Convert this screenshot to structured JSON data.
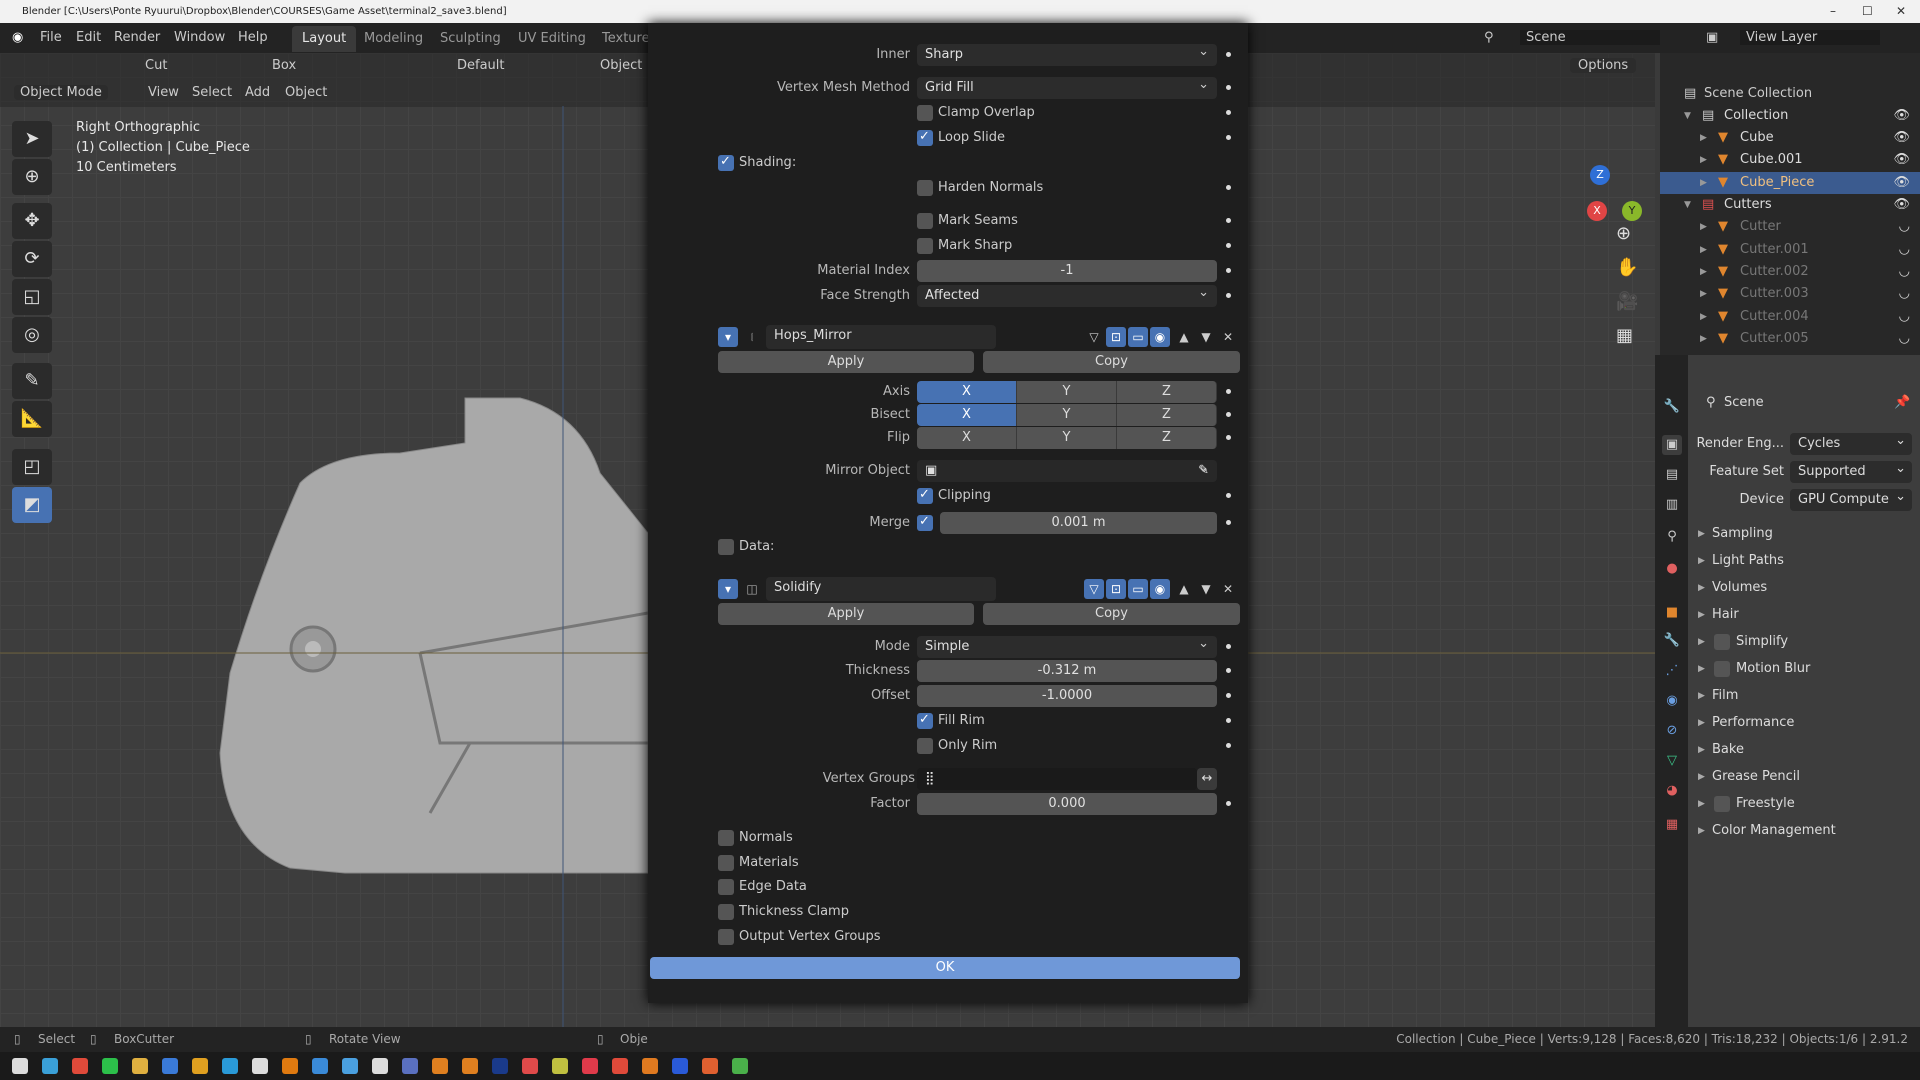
{
  "window": {
    "title": "Blender [C:\\Users\\Ponte Ryuurui\\Dropbox\\Blender\\COURSES\\Game Asset\\terminal2_save3.blend]",
    "min": "–",
    "max": "☐",
    "close": "✕"
  },
  "menu": {
    "items": [
      "File",
      "Edit",
      "Render",
      "Window",
      "Help"
    ],
    "workspaces": [
      "Layout",
      "Modeling",
      "Sculpting",
      "UV Editing",
      "Texture"
    ],
    "active_workspace": "Layout",
    "scene": "Scene",
    "view_layer": "View Layer"
  },
  "tool_header": {
    "operation": "Cut",
    "shape": "Box",
    "orientation": "Default",
    "target": "Object",
    "options": "Options"
  },
  "view_header": {
    "mode": "Object Mode",
    "items": [
      "View",
      "Select",
      "Add",
      "Object"
    ]
  },
  "viewport": {
    "view_name": "Right Orthographic",
    "context": "(1) Collection | Cube_Piece",
    "scale": "10 Centimeters",
    "gizmo": {
      "x": "X",
      "y": "Y",
      "z": "Z"
    }
  },
  "dialog": {
    "inner_label": "Inner",
    "inner_value": "Sharp",
    "vmm_label": "Vertex Mesh Method",
    "vmm_value": "Grid Fill",
    "clamp_overlap": {
      "label": "Clamp Overlap",
      "checked": false
    },
    "loop_slide": {
      "label": "Loop Slide",
      "checked": true
    },
    "shading": {
      "label": "Shading:",
      "checked": true
    },
    "harden_normals": {
      "label": "Harden Normals",
      "checked": false
    },
    "mark_seams": {
      "label": "Mark Seams",
      "checked": false
    },
    "mark_sharp": {
      "label": "Mark Sharp",
      "checked": false
    },
    "material_index_label": "Material Index",
    "material_index_value": "-1",
    "face_strength_label": "Face Strength",
    "face_strength_value": "Affected",
    "mirror": {
      "name": "Hops_Mirror",
      "apply": "Apply",
      "copy": "Copy",
      "axis_label": "Axis",
      "bisect_label": "Bisect",
      "flip_label": "Flip",
      "axes": [
        "X",
        "Y",
        "Z"
      ],
      "axis_on": [
        true,
        false,
        false
      ],
      "bisect_on": [
        true,
        false,
        false
      ],
      "flip_on": [
        false,
        false,
        false
      ],
      "mirror_object_label": "Mirror Object",
      "clipping": {
        "label": "Clipping",
        "checked": true
      },
      "merge_label": "Merge",
      "merge_checked": true,
      "merge_value": "0.001 m",
      "data": {
        "label": "Data:",
        "checked": false
      }
    },
    "solidify": {
      "name": "Solidify",
      "apply": "Apply",
      "copy": "Copy",
      "mode_label": "Mode",
      "mode_value": "Simple",
      "thickness_label": "Thickness",
      "thickness_value": "-0.312 m",
      "offset_label": "Offset",
      "offset_value": "-1.0000",
      "fill_rim": {
        "label": "Fill Rim",
        "checked": true
      },
      "only_rim": {
        "label": "Only Rim",
        "checked": false
      },
      "vertex_groups_label": "Vertex Groups",
      "factor_label": "Factor",
      "factor_value": "0.000",
      "normals": {
        "label": "Normals",
        "checked": false
      },
      "materials": {
        "label": "Materials",
        "checked": false
      },
      "edge_data": {
        "label": "Edge Data",
        "checked": false
      },
      "thickness_clamp": {
        "label": "Thickness Clamp",
        "checked": false
      },
      "output_vertex_groups": {
        "label": "Output Vertex Groups",
        "checked": false
      }
    },
    "ok": "OK"
  },
  "outliner": {
    "root": "Scene Collection",
    "items": [
      {
        "name": "Collection",
        "type": "collection",
        "level": 1
      },
      {
        "name": "Cube",
        "type": "mesh",
        "level": 2
      },
      {
        "name": "Cube.001",
        "type": "mesh",
        "level": 2
      },
      {
        "name": "Cube_Piece",
        "type": "mesh",
        "level": 2,
        "selected": true
      },
      {
        "name": "Cutters",
        "type": "collection",
        "level": 1
      },
      {
        "name": "Cutter",
        "type": "mesh",
        "level": 2,
        "hidden": true
      },
      {
        "name": "Cutter.001",
        "type": "mesh",
        "level": 2,
        "hidden": true
      },
      {
        "name": "Cutter.002",
        "type": "mesh",
        "level": 2,
        "hidden": true
      },
      {
        "name": "Cutter.003",
        "type": "mesh",
        "level": 2,
        "hidden": true
      },
      {
        "name": "Cutter.004",
        "type": "mesh",
        "level": 2,
        "hidden": true
      },
      {
        "name": "Cutter.005",
        "type": "mesh",
        "level": 2,
        "hidden": true
      }
    ]
  },
  "properties": {
    "context": "Scene",
    "render_engine_label": "Render Eng...",
    "render_engine": "Cycles",
    "feature_set_label": "Feature Set",
    "feature_set": "Supported",
    "device_label": "Device",
    "device": "GPU Compute",
    "panels": [
      "Sampling",
      "Light Paths",
      "Volumes",
      "Hair",
      "Simplify",
      "Motion Blur",
      "Film",
      "Performance",
      "Bake",
      "Grease Pencil",
      "Freestyle",
      "Color Management"
    ]
  },
  "statusbar": {
    "select": "Select",
    "boxcutter": "BoxCutter",
    "rotate": "Rotate View",
    "object": "Obje",
    "stats": "Collection | Cube_Piece | Verts:9,128 | Faces:8,620 | Tris:18,232 | Objects:1/6 | 2.91.2"
  },
  "colors": {
    "accent": "#4772b3",
    "ok": "#6f98d8",
    "selected_row": "#3b5b8f",
    "mesh_icon": "#e0862e"
  }
}
